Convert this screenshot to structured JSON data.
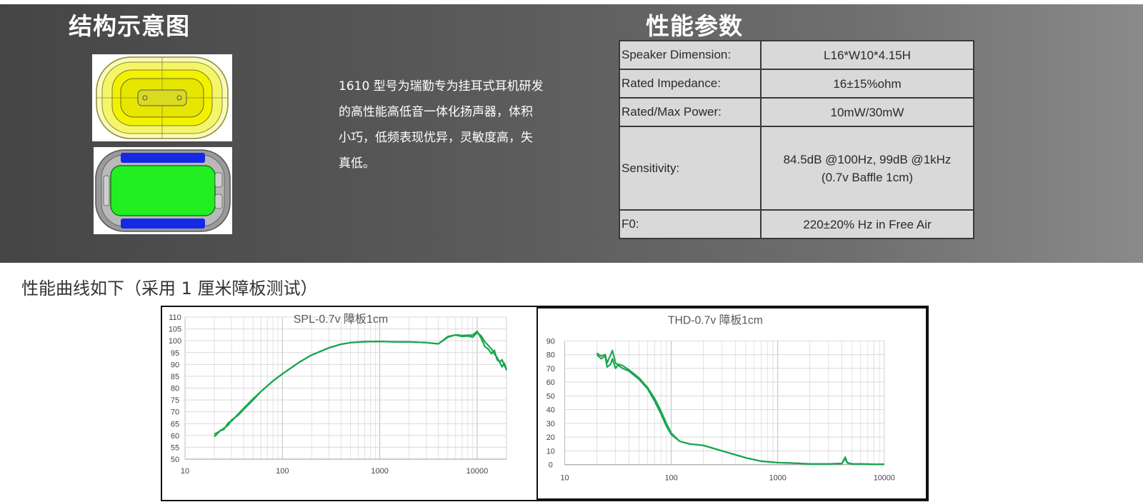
{
  "structure": {
    "title": "结构示意图",
    "images": [
      {
        "name": "speaker-top-view",
        "colors": {
          "body": "#f2f200",
          "rim": "#fafac8"
        }
      },
      {
        "name": "speaker-bottom-view",
        "colors": {
          "body": "#22ee22",
          "pads": "#1428e6",
          "frame": "#9a9a9a"
        }
      }
    ]
  },
  "description": {
    "lines": [
      "1610 型号为瑞勤专为挂耳式耳机研发",
      "的高性能高低音一体化扬声器，体积",
      "小巧，低频表现优异，灵敏度高，失",
      "真低。"
    ]
  },
  "specs": {
    "title": "性能参数",
    "rows": [
      {
        "key": "Speaker Dimension:",
        "value": "L16*W10*4.15H"
      },
      {
        "key": "Rated Impedance:",
        "value": "16±15%ohm"
      },
      {
        "key": "Rated/Max Power:",
        "value": "10mW/30mW"
      },
      {
        "key": "Sensitivity:",
        "value": "84.5dB @100Hz,  99dB @1kHz",
        "value2": "(0.7v Baffle 1cm)"
      },
      {
        "key": "F0:",
        "value": "220±20% Hz  in Free Air"
      }
    ]
  },
  "curves_title": "性能曲线如下（采用 1 厘米障板测试）",
  "chart_data": [
    {
      "type": "line",
      "title": "SPL-0.7v 障板1cm",
      "xscale": "log",
      "xlim": [
        10,
        20000
      ],
      "ylim": [
        50,
        110
      ],
      "xticks": [
        "10",
        "100",
        "1000",
        "10000"
      ],
      "yticks": [
        "110",
        "105",
        "100",
        "95",
        "90",
        "85",
        "80",
        "75",
        "70",
        "65",
        "60",
        "55",
        "50"
      ],
      "grid": true,
      "color": "#1aa64f",
      "series": [
        {
          "x": [
            20,
            23,
            25,
            28,
            30,
            35,
            40,
            50,
            60,
            80,
            100,
            150,
            200,
            300,
            400,
            500,
            700,
            1000,
            1500,
            2000,
            3000,
            4000,
            5000,
            6000,
            7000,
            8000,
            9000,
            10000,
            11000,
            12000,
            13000,
            14000,
            15000,
            16000,
            17000,
            18000,
            19000,
            20000
          ],
          "values": [
            59.5,
            62,
            62.5,
            65.5,
            66,
            69,
            71.5,
            75.5,
            78.5,
            83,
            86,
            91,
            94,
            97,
            98.5,
            99.2,
            99.6,
            99.7,
            99.5,
            99.5,
            99.2,
            98.7,
            101.5,
            102.5,
            102.2,
            102.3,
            102.4,
            104,
            101,
            97.5,
            96.5,
            94.5,
            96,
            92,
            91,
            89,
            90.5,
            87.5
          ]
        },
        {
          "x": [
            20,
            22,
            25,
            28,
            30,
            35,
            40,
            50,
            60,
            80,
            100,
            150,
            200,
            300,
            400,
            500,
            700,
            1000,
            1500,
            2000,
            3000,
            4000,
            5000,
            6000,
            7000,
            8000,
            9000,
            10000,
            11000,
            12000,
            13000,
            14000,
            15000,
            16000,
            17000,
            18000,
            19000,
            20000
          ],
          "values": [
            60.5,
            61.5,
            63,
            64.5,
            66.5,
            68.5,
            71,
            75,
            78.5,
            83,
            86,
            91,
            94,
            97,
            98.5,
            99.2,
            99.6,
            99.7,
            99.5,
            99.5,
            99.2,
            98.7,
            101.8,
            102.4,
            101.8,
            102,
            101.5,
            103.5,
            102,
            99.5,
            98,
            96.5,
            94.5,
            93,
            91,
            92,
            89.5,
            88
          ]
        }
      ]
    },
    {
      "type": "line",
      "title": "THD-0.7v 障板1cm",
      "xscale": "log",
      "xlim": [
        10,
        10000
      ],
      "ylim": [
        0,
        90
      ],
      "xticks": [
        "10",
        "100",
        "1000",
        "10000"
      ],
      "yticks": [
        "90",
        "80",
        "70",
        "60",
        "50",
        "40",
        "30",
        "20",
        "10",
        "0"
      ],
      "grid": true,
      "color": "#1aa64f",
      "series": [
        {
          "x": [
            20,
            22,
            24,
            25,
            27,
            28,
            30,
            32,
            35,
            40,
            50,
            60,
            70,
            80,
            90,
            100,
            120,
            150,
            200,
            300,
            500,
            700,
            1000,
            1500,
            2000,
            3000,
            4000,
            4300,
            4500,
            5000,
            6000,
            8000,
            10000
          ],
          "values": [
            81,
            79,
            80,
            74,
            80,
            83,
            74,
            72,
            70,
            68,
            62,
            55,
            46,
            37,
            28,
            22,
            17,
            15,
            14,
            10,
            5,
            2.5,
            1.5,
            1,
            0.5,
            0.5,
            0.8,
            5.5,
            1.5,
            0.5,
            0.5,
            0.3,
            0.3
          ]
        },
        {
          "x": [
            20,
            22,
            24,
            25,
            27,
            28,
            30,
            32,
            35,
            40,
            50,
            60,
            70,
            80,
            90,
            100,
            120,
            150,
            200,
            300,
            500,
            700,
            1000,
            1500,
            2000,
            3000,
            4000,
            4300,
            4500,
            5000,
            6000,
            8000,
            10000
          ],
          "values": [
            80,
            77,
            79,
            71,
            73,
            77,
            70,
            73,
            72,
            69,
            63,
            56,
            48,
            39,
            30,
            23,
            17,
            15,
            14,
            10,
            5,
            2.5,
            1.5,
            1,
            0.5,
            0.5,
            0.8,
            4.5,
            1.2,
            0.5,
            0.5,
            0.3,
            0.3
          ]
        }
      ]
    }
  ]
}
